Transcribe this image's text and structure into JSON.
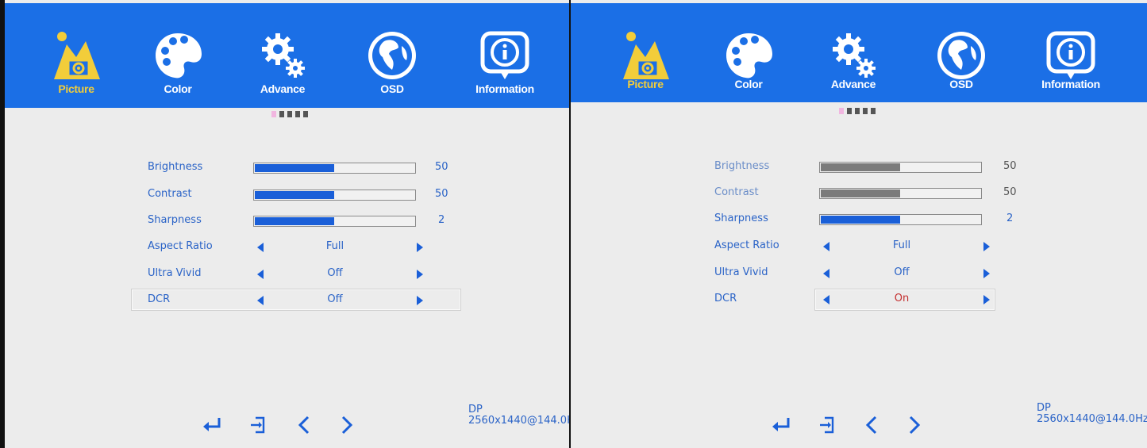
{
  "tabs": [
    {
      "label": "Picture",
      "icon": "picture-icon",
      "active": true
    },
    {
      "label": "Color",
      "icon": "palette-icon"
    },
    {
      "label": "Advance",
      "icon": "gears-icon"
    },
    {
      "label": "OSD",
      "icon": "globe-icon"
    },
    {
      "label": "Information",
      "icon": "info-icon"
    }
  ],
  "colors": {
    "header": "#1b6fe6",
    "accent_active": "#f2cd3a",
    "text_blue": "#2a63c7",
    "bar_fill": "#1a5fd8",
    "bar_dim": "#7b7b7b",
    "value_on": "#c43030"
  },
  "left": {
    "brightness": {
      "label": "Brightness",
      "value": "50",
      "level": 0.5
    },
    "contrast": {
      "label": "Contrast",
      "value": "50",
      "level": 0.5
    },
    "sharpness": {
      "label": "Sharpness",
      "value": "2",
      "level": 0.5
    },
    "aspect_ratio": {
      "label": "Aspect Ratio",
      "value": "Full"
    },
    "ultra_vivid": {
      "label": "Ultra Vivid",
      "value": "Off"
    },
    "dcr": {
      "label": "DCR",
      "value": "Off"
    }
  },
  "right": {
    "brightness": {
      "label": "Brightness",
      "value": "50",
      "level": 0.5
    },
    "contrast": {
      "label": "Contrast",
      "value": "50",
      "level": 0.5
    },
    "sharpness": {
      "label": "Sharpness",
      "value": "2",
      "level": 0.5
    },
    "aspect_ratio": {
      "label": "Aspect Ratio",
      "value": "Full"
    },
    "ultra_vivid": {
      "label": "Ultra Vivid",
      "value": "Off"
    },
    "dcr": {
      "label": "DCR",
      "value": "On"
    }
  },
  "status": {
    "input": "DP",
    "mode": "2560x1440@144.0Hz"
  },
  "nav_keys": [
    "enter-icon",
    "exit-icon",
    "left-chevron-icon",
    "right-chevron-icon"
  ]
}
